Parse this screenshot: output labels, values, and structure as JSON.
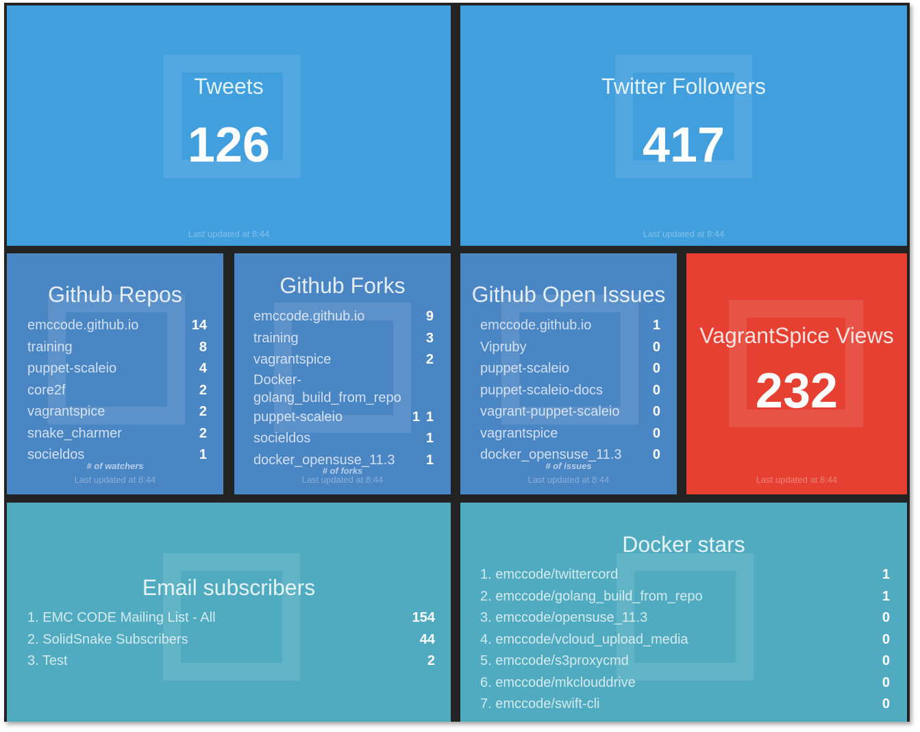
{
  "tiles": {
    "tweets": {
      "title": "Tweets",
      "value": "126",
      "updated": "Last updated at 8:44"
    },
    "twitter_followers": {
      "title": "Twitter Followers",
      "value": "417",
      "updated": "Last updated at 8:44"
    },
    "github_repos": {
      "title": "Github Repos",
      "items": [
        {
          "label": "emccode.github.io",
          "value": "14"
        },
        {
          "label": "training",
          "value": "8"
        },
        {
          "label": "puppet-scaleio",
          "value": "4"
        },
        {
          "label": "core2f",
          "value": "2"
        },
        {
          "label": "vagrantspice",
          "value": "2"
        },
        {
          "label": "snake_charmer",
          "value": "2"
        },
        {
          "label": "socieldos",
          "value": "1"
        }
      ],
      "more_info": "# of watchers",
      "updated": "Last updated at 8:44"
    },
    "github_forks": {
      "title": "Github Forks",
      "items": [
        {
          "label": "emccode.github.io",
          "value": "9"
        },
        {
          "label": "training",
          "value": "3"
        },
        {
          "label": "vagrantspice",
          "value": "2"
        },
        {
          "label": "Docker-",
          "value": ""
        },
        {
          "label": "golang_build_from_repo",
          "value": ""
        },
        {
          "label": "puppet-scaleio",
          "value": "1"
        },
        {
          "label": "socieldos",
          "value": "1"
        },
        {
          "label": "docker_opensuse_11.3",
          "value": "1"
        }
      ],
      "stray_value": "1",
      "more_info": "# of forks",
      "updated": "Last updated at 8:44"
    },
    "github_issues": {
      "title": "Github Open Issues",
      "items": [
        {
          "label": "emccode.github.io",
          "value": "1"
        },
        {
          "label": "Vipruby",
          "value": "0"
        },
        {
          "label": "puppet-scaleio",
          "value": "0"
        },
        {
          "label": "puppet-scaleio-docs",
          "value": "0"
        },
        {
          "label": "vagrant-puppet-scaleio",
          "value": "0"
        },
        {
          "label": "vagrantspice",
          "value": "0"
        },
        {
          "label": "docker_opensuse_11.3",
          "value": "0"
        }
      ],
      "more_info": "# of issues",
      "updated": "Last updated at 8:44"
    },
    "vagrantspice_views": {
      "title": "VagrantSpice Views",
      "value": "232",
      "updated": "Last updated at 8:44"
    },
    "email_subscribers": {
      "title": "Email subscribers",
      "items": [
        {
          "label": "1. EMC CODE Mailing List - All",
          "value": "154"
        },
        {
          "label": "2. SolidSnake Subscribers",
          "value": "44"
        },
        {
          "label": "3. Test",
          "value": "2"
        }
      ]
    },
    "docker_stars": {
      "title": "Docker stars",
      "items": [
        {
          "label": "1. emccode/twittercord",
          "value": "1"
        },
        {
          "label": "2. emccode/golang_build_from_repo",
          "value": "1"
        },
        {
          "label": "3. emccode/opensuse_11.3",
          "value": "0"
        },
        {
          "label": "4. emccode/vcloud_upload_media",
          "value": "0"
        },
        {
          "label": "5. emccode/s3proxycmd",
          "value": "0"
        },
        {
          "label": "6. emccode/mkclouddrive",
          "value": "0"
        },
        {
          "label": "7. emccode/swift-cli",
          "value": "0"
        }
      ]
    }
  },
  "colors": {
    "border": "#232323",
    "tweets_bg": "#419fde",
    "github_bg": "#4a85c4",
    "views_bg": "#e54032",
    "bottom_bg": "#50abc0"
  },
  "icons": {
    "watermark": "square-outline-icon"
  }
}
